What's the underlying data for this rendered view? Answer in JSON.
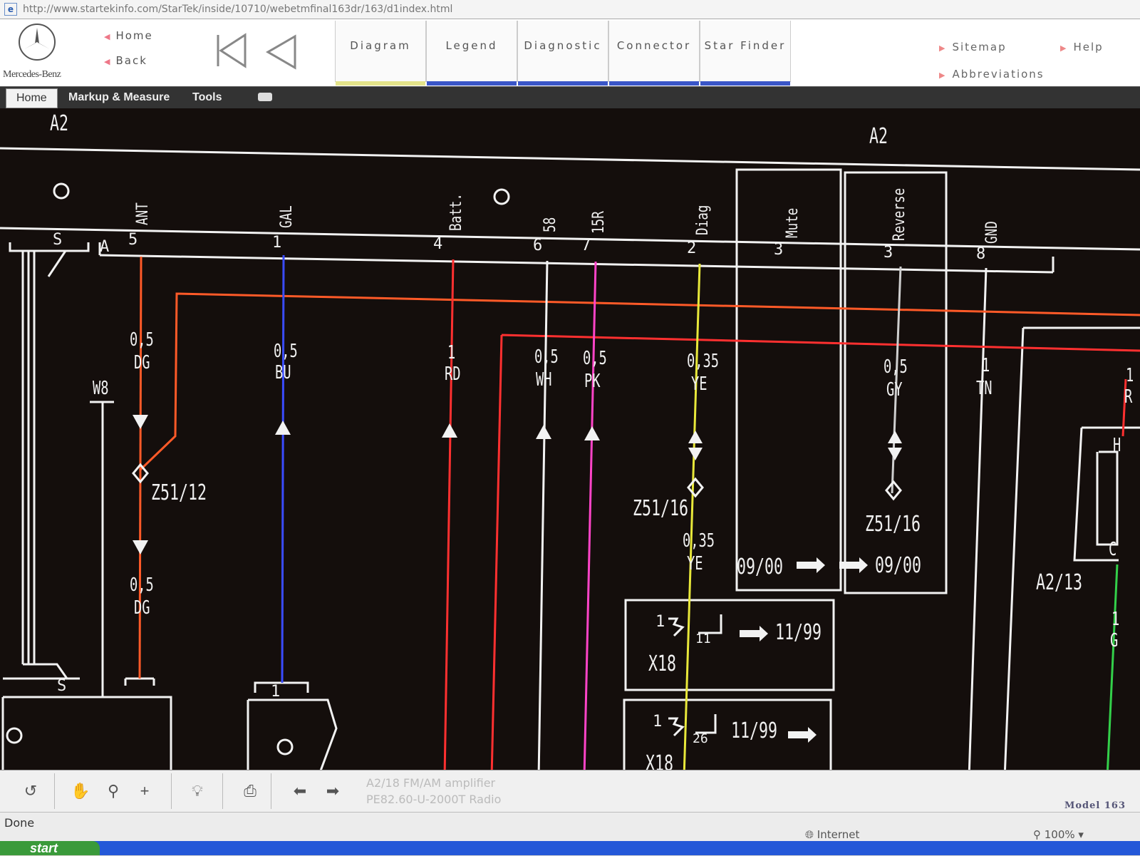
{
  "browser": {
    "url": "http://www.startekinfo.com/StarTek/inside/10710/webetmfinal163dr/163/d1index.html"
  },
  "header": {
    "brand": "Mercedes-Benz",
    "nav": {
      "home": "Home",
      "back": "Back"
    },
    "tabs": [
      {
        "label": "Diagram",
        "bar": "#e4e48a"
      },
      {
        "label": "Legend",
        "bar": "#3a56c8"
      },
      {
        "label": "Diagnostic",
        "bar": "#3a56c8"
      },
      {
        "label": "Connector",
        "bar": "#3a56c8"
      },
      {
        "label": "Star Finder",
        "bar": "#3a56c8"
      }
    ],
    "links": {
      "sitemap": "Sitemap",
      "abbreviations": "Abbreviations",
      "help": "Help"
    }
  },
  "toolbar": {
    "home": "Home",
    "markup": "Markup & Measure",
    "tools": "Tools"
  },
  "diagram": {
    "title_left": "A2",
    "title_right": "A2",
    "pins": [
      {
        "name": "ANT",
        "pin": "5"
      },
      {
        "name": "GAL",
        "pin": "1"
      },
      {
        "name": "Batt.",
        "pin": "4"
      },
      {
        "name": "58",
        "pin": "6"
      },
      {
        "name": "15R",
        "pin": "7"
      },
      {
        "name": "Diag",
        "pin": "2"
      },
      {
        "name": "Mute",
        "pin": "3"
      },
      {
        "name": "Reverse",
        "pin": "3"
      },
      {
        "name": "GND",
        "pin": "8"
      }
    ],
    "connector_label": "A",
    "switch_label": "S",
    "wires": [
      {
        "size": "0,5",
        "color_code": "DG"
      },
      {
        "size": "0,5",
        "color_code": "BU"
      },
      {
        "size": "1",
        "color_code": "RD"
      },
      {
        "size": "0,5",
        "color_code": "WH"
      },
      {
        "size": "0,5",
        "color_code": "PK"
      },
      {
        "size": "0,35",
        "color_code": "YE"
      },
      {
        "size": "0,5",
        "color_code": "GY"
      },
      {
        "size": "1",
        "color_code": "TN"
      }
    ],
    "lower_wires": [
      {
        "size": "0,5",
        "color_code": "DG"
      },
      {
        "size": "0,35",
        "color_code": "YE"
      }
    ],
    "w8": "W8",
    "splices": {
      "left": "Z51/12",
      "mid": "Z51/16",
      "right": "Z51/16"
    },
    "mute_box": "09/00",
    "reverse_box": "09/00",
    "x18_a": {
      "name": "X18",
      "pin": "1",
      "num": "11",
      "date": "11/99"
    },
    "x18_b": {
      "name": "X18",
      "pin": "1",
      "num": "26",
      "date": "11/99"
    },
    "a2_13": "A2/13",
    "edge_labels": {
      "r1": "1",
      "r2": "R",
      "h": "H",
      "c": "C",
      "g1": "1",
      "g2": "G"
    },
    "bottom_pin_left": "S",
    "bottom_pin_gal": "1"
  },
  "bottom": {
    "desc1": "A2/18  FM/AM amplifier",
    "desc2": "PE82.60-U-2000T   Radio",
    "model": "Model 163"
  },
  "status": {
    "done": "Done",
    "zone": "Internet",
    "zoom": "100%"
  },
  "taskbar": {
    "start": "start"
  }
}
